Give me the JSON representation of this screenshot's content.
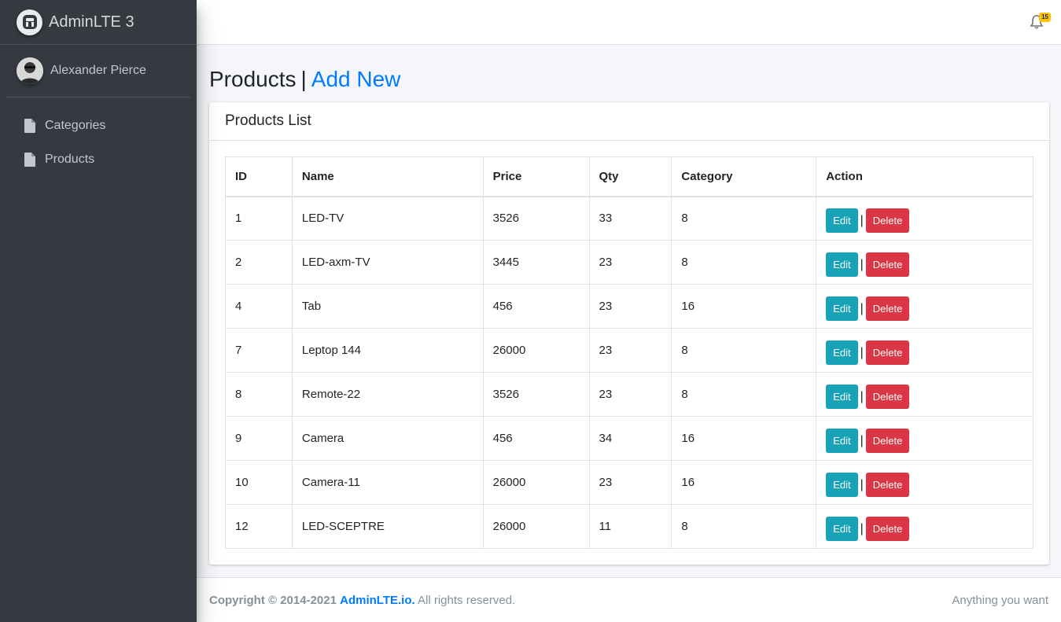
{
  "brand": {
    "name": "AdminLTE 3"
  },
  "user": {
    "name": "Alexander Pierce"
  },
  "sidebar": {
    "items": [
      {
        "label": "Categories",
        "icon": "file-icon"
      },
      {
        "label": "Products",
        "icon": "file-icon"
      }
    ]
  },
  "navbar": {
    "notifications_count": "15"
  },
  "page": {
    "title": "Products",
    "separator": "|",
    "add_new_label": "Add New"
  },
  "card": {
    "title": "Products List"
  },
  "table": {
    "headers": [
      "ID",
      "Name",
      "Price",
      "Qty",
      "Category",
      "Action"
    ],
    "rows": [
      {
        "id": "1",
        "name": "LED-TV",
        "price": "3526",
        "qty": "33",
        "category": "8"
      },
      {
        "id": "2",
        "name": "LED-axm-TV",
        "price": "3445",
        "qty": "23",
        "category": "8"
      },
      {
        "id": "4",
        "name": "Tab",
        "price": "456",
        "qty": "23",
        "category": "16"
      },
      {
        "id": "7",
        "name": "Leptop 144",
        "price": "26000",
        "qty": "23",
        "category": "8"
      },
      {
        "id": "8",
        "name": "Remote-22",
        "price": "3526",
        "qty": "23",
        "category": "8"
      },
      {
        "id": "9",
        "name": "Camera",
        "price": "456",
        "qty": "34",
        "category": "16"
      },
      {
        "id": "10",
        "name": "Camera-11",
        "price": "26000",
        "qty": "23",
        "category": "16"
      },
      {
        "id": "12",
        "name": "LED-SCEPTRE",
        "price": "26000",
        "qty": "11",
        "category": "8"
      }
    ],
    "edit_label": "Edit",
    "delete_label": "Delete",
    "action_separator": "|"
  },
  "footer": {
    "copyright_prefix": "Copyright © 2014-2021",
    "link_text": "AdminLTE.io.",
    "suffix": "All rights reserved.",
    "right_text": "Anything you want"
  },
  "colors": {
    "sidebar_bg": "#343a40",
    "link": "#007bff",
    "edit": "#17a2b8",
    "delete": "#dc3545",
    "badge": "#ffc107"
  }
}
